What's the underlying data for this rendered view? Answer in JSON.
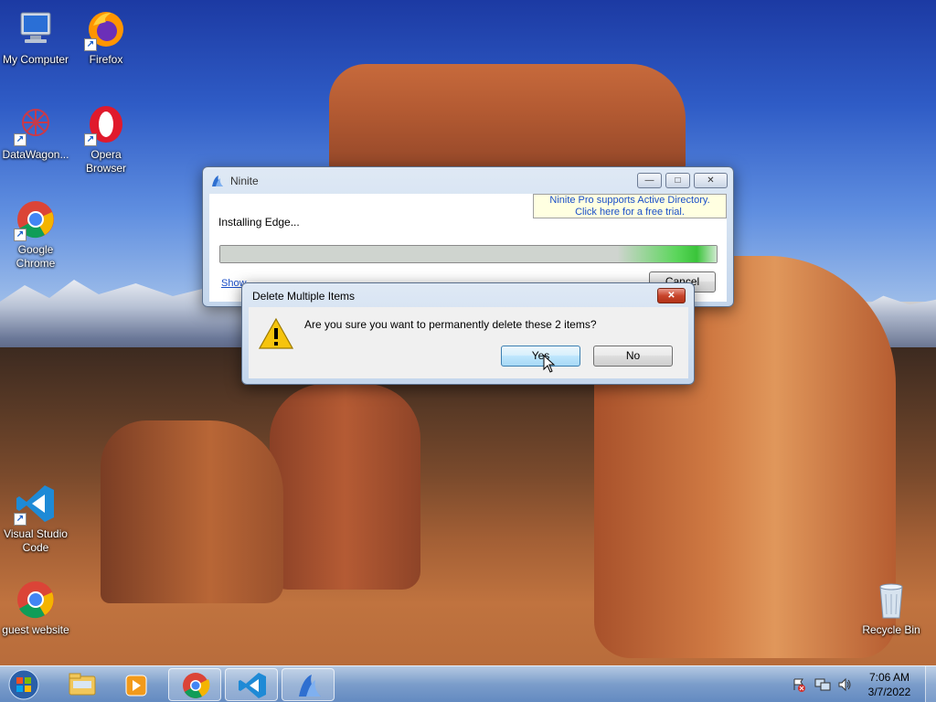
{
  "desktop": {
    "icons": [
      {
        "label": "My Computer"
      },
      {
        "label": "Firefox"
      },
      {
        "label": "DataWagon..."
      },
      {
        "label": "Opera Browser"
      },
      {
        "label": "Google Chrome"
      },
      {
        "label": "Visual Studio Code"
      },
      {
        "label": "guest website"
      },
      {
        "label": "Recycle Bin"
      }
    ]
  },
  "ninite": {
    "title": "Ninite",
    "ad_line1": "Ninite Pro supports Active Directory.",
    "ad_line2": "Click here for a free trial.",
    "status": "Installing Edge...",
    "progress": 1.0,
    "show_link": "Show",
    "cancel_label": "Cancel",
    "minimize_glyph": "—",
    "maximize_glyph": "□",
    "close_glyph": "✕"
  },
  "dialog": {
    "title": "Delete Multiple Items",
    "message": "Are you sure you want to permanently delete these 2 items?",
    "yes_label": "Yes",
    "no_label": "No",
    "close_glyph": "✕",
    "icon": "warning-icon"
  },
  "taskbar": {
    "time": "7:06 AM",
    "date": "3/7/2022",
    "items": [
      "start-button",
      "file-explorer",
      "media-player",
      "chrome",
      "vscode",
      "ninite"
    ]
  },
  "colors": {
    "accent": "#3c7fb1",
    "progress_green": "#3ac43a",
    "link": "#1b4fc8"
  }
}
